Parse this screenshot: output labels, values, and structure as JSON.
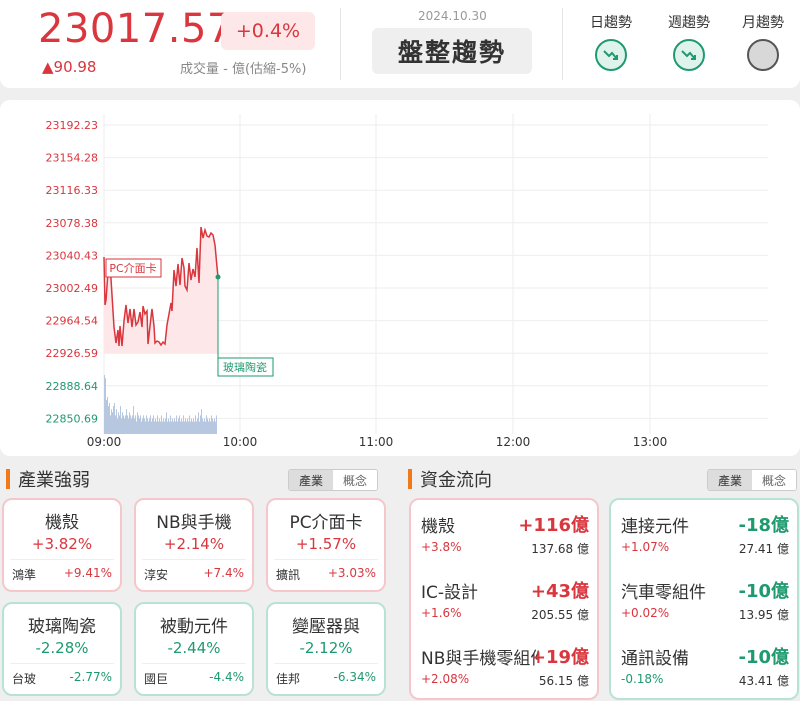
{
  "header": {
    "index_value": "23017.57",
    "pct_change": "+0.4%",
    "change": "▲90.98",
    "volume": "成交量 - 億(估縮-5%)",
    "date": "2024.10.30",
    "trend_label": "盤整趨勢",
    "trends": [
      {
        "label": "日趨勢",
        "state": "down"
      },
      {
        "label": "週趨勢",
        "state": "down"
      },
      {
        "label": "月趨勢",
        "state": "none"
      }
    ]
  },
  "chart_data": {
    "type": "line",
    "y_ticks": [
      "23192.23",
      "23154.28",
      "23116.33",
      "23078.38",
      "23040.43",
      "23002.49",
      "22964.54",
      "22926.59",
      "22888.64",
      "22850.69"
    ],
    "x_ticks": [
      "09:00",
      "10:00",
      "11:00",
      "12:00",
      "13:00"
    ],
    "ylim": [
      22850.69,
      23192.23
    ],
    "reference": 22926.59,
    "annotations": [
      "PC介面卡",
      "玻璃陶瓷"
    ],
    "colors": {
      "up": "#d9363e",
      "down": "#1f9a6e",
      "fill": "#fde7e8",
      "volume": "#b7c7e0"
    }
  },
  "industry": {
    "title": "產業強弱",
    "tabs": [
      "產業",
      "概念"
    ],
    "cards": [
      {
        "name": "機殼",
        "pct": "+3.82%",
        "stock": "鴻準",
        "stock_pct": "+9.41%",
        "dir": "up"
      },
      {
        "name": "NB與手機",
        "pct": "+2.14%",
        "stock": "淳安",
        "stock_pct": "+7.4%",
        "dir": "up"
      },
      {
        "name": "PC介面卡",
        "pct": "+1.57%",
        "stock": "擴訊",
        "stock_pct": "+3.03%",
        "dir": "up"
      },
      {
        "name": "玻璃陶瓷",
        "pct": "-2.28%",
        "stock": "台玻",
        "stock_pct": "-2.77%",
        "dir": "down"
      },
      {
        "name": "被動元件",
        "pct": "-2.44%",
        "stock": "國巨",
        "stock_pct": "-4.4%",
        "dir": "down"
      },
      {
        "name": "變壓器與",
        "pct": "-2.12%",
        "stock": "佳邦",
        "stock_pct": "-6.34%",
        "dir": "down"
      }
    ]
  },
  "flow": {
    "title": "資金流向",
    "tabs": [
      "產業",
      "概念"
    ],
    "inflow": [
      {
        "name": "機殼",
        "amount": "+116億",
        "pct": "+3.8%",
        "value": "137.68 億"
      },
      {
        "name": "IC-設計",
        "amount": "+43億",
        "pct": "+1.6%",
        "value": "205.55 億"
      },
      {
        "name": "NB與手機零組件",
        "amount": "+19億",
        "pct": "+2.08%",
        "value": "56.15 億"
      }
    ],
    "outflow": [
      {
        "name": "連接元件",
        "amount": "-18億",
        "pct": "+1.07%",
        "value": "27.41 億"
      },
      {
        "name": "汽車零組件",
        "amount": "-10億",
        "pct": "+0.02%",
        "value": "13.95 億"
      },
      {
        "name": "通訊設備",
        "amount": "-10億",
        "pct": "-0.18%",
        "value": "43.41 億"
      }
    ]
  }
}
